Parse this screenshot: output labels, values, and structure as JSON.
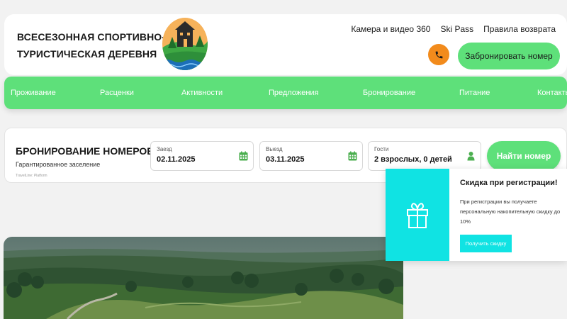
{
  "header": {
    "brand": "ВСЕСЕЗОННАЯ СПОРТИВНО-\nТУРИСТИЧЕСКАЯ ДЕРЕВНЯ",
    "top_links": [
      "Камера и видео 360",
      "Ski Pass",
      "Правила возврата"
    ],
    "phone_icon": "phone-icon",
    "book_label": "Забронировать номер"
  },
  "nav": {
    "items": [
      "Проживание",
      "Расценки",
      "Активности",
      "Предложения",
      "Бронирование",
      "Питание",
      "Контакты"
    ]
  },
  "booking": {
    "title": "БРОНИРОВАНИЕ НОМЕРОВ",
    "subtitle": "Гарантированное заселение",
    "provider": "TravelLine: Platform",
    "checkin": {
      "label": "Заезд",
      "value": "02.11.2025"
    },
    "checkout": {
      "label": "Выезд",
      "value": "03.11.2025"
    },
    "guests": {
      "label": "Гости",
      "value": "2 взрослых, 0 детей"
    },
    "find_label": "Найти номер"
  },
  "promo": {
    "title": "Скидка при регистрации!",
    "text": "При регистрации вы получаете персональную накопительную скидку до 10%",
    "button": "Получить скидку",
    "icon": "gift-icon"
  },
  "colors": {
    "accent_green": "#5ee07a",
    "phone_orange": "#f28b1c",
    "promo_cyan": "#10e3e3",
    "calendar_icon": "#4caf50"
  }
}
